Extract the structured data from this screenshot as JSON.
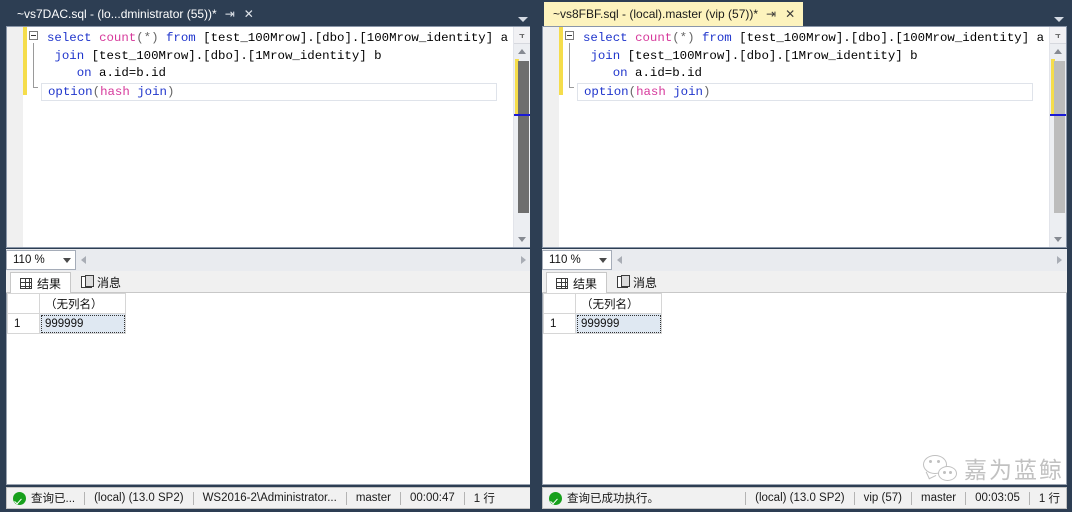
{
  "window": {
    "background_color": "#2d3e53"
  },
  "panels": [
    {
      "id": "left",
      "tab": {
        "title": "~vs7DAC.sql - (lo...dministrator (55))*",
        "pin_icon": "⇥",
        "close_icon": "✕",
        "background_color": "#2d3e53",
        "text_color": "#ffffff"
      },
      "editor": {
        "lines": [
          {
            "tokens": [
              {
                "t": "select",
                "c": "kw"
              },
              {
                "t": " ",
                "c": "plain"
              },
              {
                "t": "count",
                "c": "fn"
              },
              {
                "t": "(*) ",
                "c": "op"
              },
              {
                "t": "from",
                "c": "kw"
              },
              {
                "t": " [test_100Mrow].[dbo].[100Mrow_identity] a",
                "c": "plain"
              }
            ]
          },
          {
            "tokens": [
              {
                "t": " ",
                "c": "plain"
              },
              {
                "t": "join",
                "c": "kw"
              },
              {
                "t": " [test_100Mrow].[dbo].[1Mrow_identity] b",
                "c": "plain"
              }
            ]
          },
          {
            "tokens": [
              {
                "t": "    ",
                "c": "plain"
              },
              {
                "t": "on",
                "c": "kw"
              },
              {
                "t": " a.id=b.id",
                "c": "plain"
              }
            ]
          },
          {
            "tokens": [
              {
                "t": "option",
                "c": "kw"
              },
              {
                "t": "(",
                "c": "op"
              },
              {
                "t": "hash",
                "c": "fn"
              },
              {
                "t": " ",
                "c": "plain"
              },
              {
                "t": "join",
                "c": "kw"
              },
              {
                "t": ")",
                "c": "op"
              }
            ],
            "boxed": true
          }
        ],
        "scrollbar": {
          "split_icon": "⫟",
          "up_icon": "▲",
          "down_icon": "▼",
          "thumb_state": "active",
          "change_bar_color": "#f5dd4b",
          "marker_color": "#1a1ad6"
        }
      },
      "zoom": {
        "value": "110 %",
        "caret_icon": "chevron-down-icon"
      },
      "result_tabs": [
        {
          "label": "结果",
          "icon": "grid-icon",
          "active": true
        },
        {
          "label": "消息",
          "icon": "message-icon",
          "active": false
        }
      ],
      "grid": {
        "columns": [
          "",
          "（无列名）"
        ],
        "rows": [
          {
            "row_header": "1",
            "values": [
              "999999"
            ]
          }
        ],
        "selected_cell": "999999"
      },
      "status": {
        "icon": "success-check-icon",
        "message": "查询已...",
        "server": "(local) (13.0 SP2)",
        "user": "WS2016-2\\Administrator...",
        "database": "master",
        "elapsed": "00:00:47",
        "rows": "1 行"
      }
    },
    {
      "id": "right",
      "tab": {
        "title": "~vs8FBF.sql - (local).master (vip (57))*",
        "pin_icon": "⇥",
        "close_icon": "✕",
        "background_color": "#fdf3bd",
        "text_color": "#1b1b1b"
      },
      "editor": {
        "lines": [
          {
            "tokens": [
              {
                "t": "select",
                "c": "kw"
              },
              {
                "t": " ",
                "c": "plain"
              },
              {
                "t": "count",
                "c": "fn"
              },
              {
                "t": "(*) ",
                "c": "op"
              },
              {
                "t": "from",
                "c": "kw"
              },
              {
                "t": " [test_100Mrow].[dbo].[100Mrow_identity] a",
                "c": "plain"
              }
            ]
          },
          {
            "tokens": [
              {
                "t": " ",
                "c": "plain"
              },
              {
                "t": "join",
                "c": "kw"
              },
              {
                "t": " [test_100Mrow].[dbo].[1Mrow_identity] b",
                "c": "plain"
              }
            ]
          },
          {
            "tokens": [
              {
                "t": "    ",
                "c": "plain"
              },
              {
                "t": "on",
                "c": "kw"
              },
              {
                "t": " a.id=b.id",
                "c": "plain"
              }
            ]
          },
          {
            "tokens": [
              {
                "t": "option",
                "c": "kw"
              },
              {
                "t": "(",
                "c": "op"
              },
              {
                "t": "hash",
                "c": "fn"
              },
              {
                "t": " ",
                "c": "plain"
              },
              {
                "t": "join",
                "c": "kw"
              },
              {
                "t": ")",
                "c": "op"
              }
            ],
            "boxed": true
          }
        ],
        "scrollbar": {
          "split_icon": "⫟",
          "up_icon": "▲",
          "down_icon": "▼",
          "thumb_state": "inactive",
          "change_bar_color": "#f5dd4b",
          "marker_color": "#1a1ad6"
        }
      },
      "zoom": {
        "value": "110 %",
        "caret_icon": "chevron-down-icon"
      },
      "result_tabs": [
        {
          "label": "结果",
          "icon": "grid-icon",
          "active": true
        },
        {
          "label": "消息",
          "icon": "message-icon",
          "active": false
        }
      ],
      "grid": {
        "columns": [
          "",
          "（无列名）"
        ],
        "rows": [
          {
            "row_header": "1",
            "values": [
              "999999"
            ]
          }
        ],
        "selected_cell": "999999"
      },
      "status": {
        "icon": "success-check-icon",
        "message": "查询已成功执行。",
        "server": "(local) (13.0 SP2)",
        "user": "vip (57)",
        "database": "master",
        "elapsed": "00:03:05",
        "rows": "1 行"
      }
    }
  ],
  "watermark": {
    "text": "嘉为蓝鲸",
    "logo": "wechat-logo"
  }
}
